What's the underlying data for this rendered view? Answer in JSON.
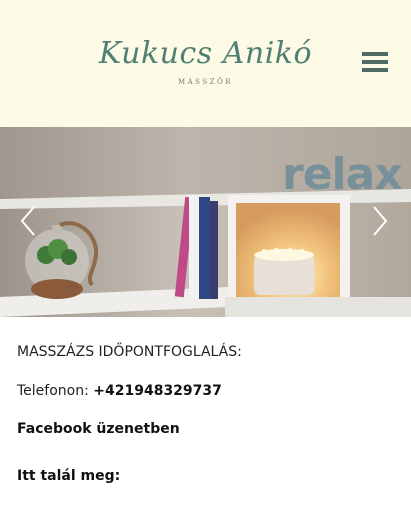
{
  "brand": {
    "name": "Kukucs Anikó",
    "subtitle": "MASSZŐR"
  },
  "icons": {
    "menu": "hamburger-menu-icon",
    "prev": "chevron-left-icon",
    "next": "chevron-right-icon"
  },
  "colors": {
    "header_bg": "#fdfae6",
    "brand": "#4f8073",
    "menu": "#4f6b66"
  },
  "slider": {
    "image_text": "relax"
  },
  "content": {
    "heading": "MASSZÁZS IDŐPONTFOGLALÁS:",
    "phone_label": "Telefonon: ",
    "phone_number": "+421948329737",
    "facebook": "Facebook üzenetben",
    "find_us": "Itt talál meg:"
  }
}
